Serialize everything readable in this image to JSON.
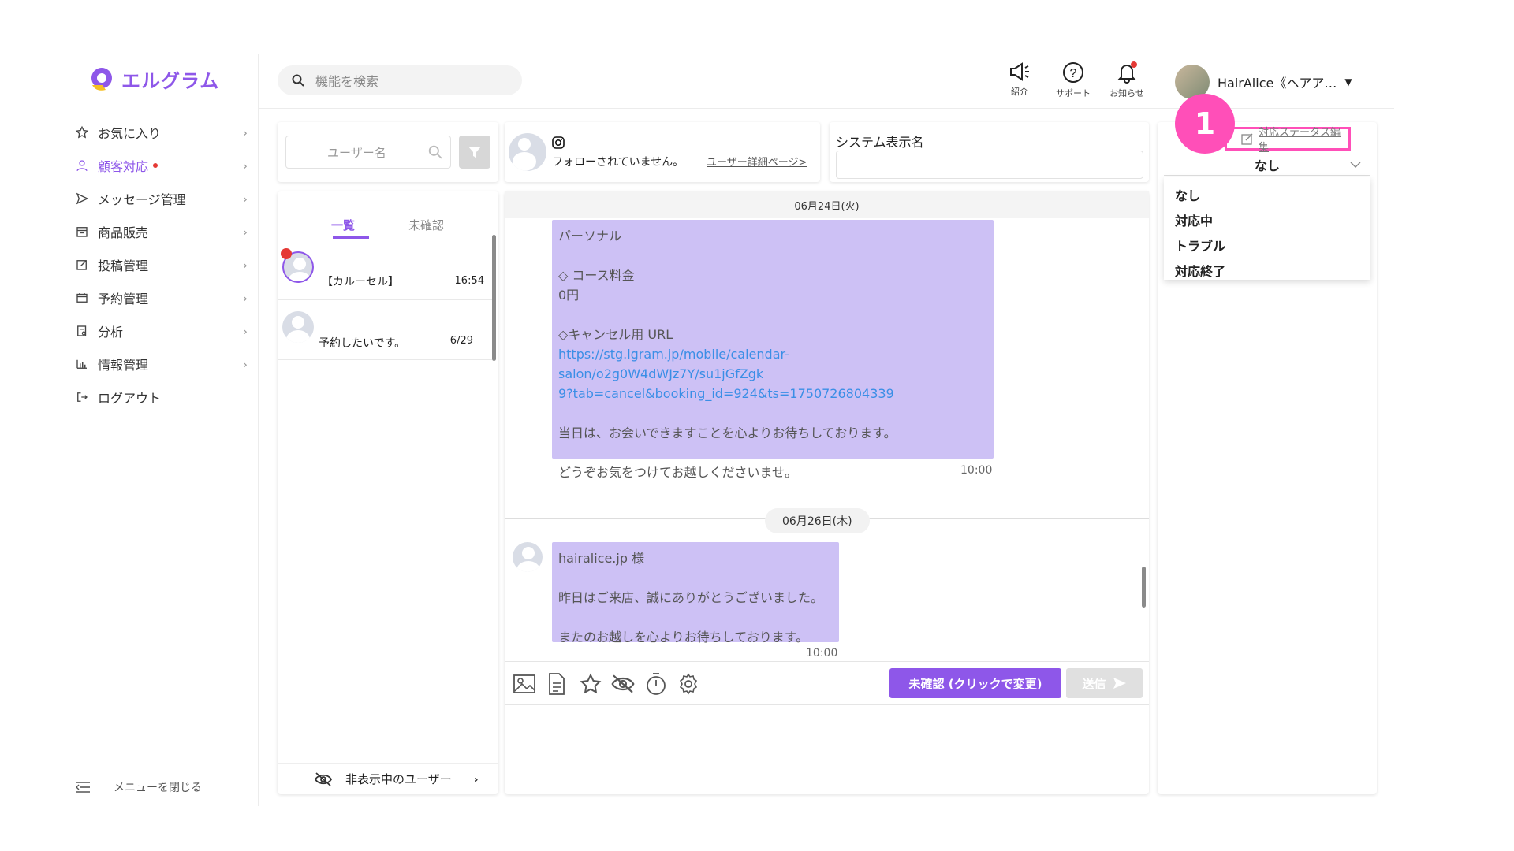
{
  "app": {
    "name": "エルグラム"
  },
  "search": {
    "placeholder": "機能を検索"
  },
  "header": {
    "icons": [
      {
        "name": "megaphone-icon",
        "label": "紹介"
      },
      {
        "name": "help-icon",
        "label": "サポート"
      },
      {
        "name": "bell-icon",
        "label": "お知らせ"
      }
    ],
    "user_name": "HairAlice《ヘアア…"
  },
  "sidebar": {
    "items": [
      {
        "label": "お気に入り",
        "icon": "star-icon"
      },
      {
        "label": "顧客対応",
        "icon": "person-icon",
        "active": true,
        "badge": true
      },
      {
        "label": "メッセージ管理",
        "icon": "send-icon"
      },
      {
        "label": "商品販売",
        "icon": "store-icon"
      },
      {
        "label": "投稿管理",
        "icon": "edit-icon"
      },
      {
        "label": "予約管理",
        "icon": "calendar-icon"
      },
      {
        "label": "分析",
        "icon": "report-icon"
      },
      {
        "label": "情報管理",
        "icon": "bar-chart-icon"
      },
      {
        "label": "ログアウト",
        "icon": "logout-icon"
      }
    ],
    "close_menu": "メニューを閉じる"
  },
  "user_list": {
    "search_placeholder": "ユーザー名",
    "tabs": [
      "一覧",
      "未確認"
    ],
    "rows": [
      {
        "message": "【カルーセル】",
        "time": "16:54",
        "unread": true
      },
      {
        "message": "予約したいです。",
        "time": "6/29",
        "unread": false
      }
    ],
    "hidden_users": "非表示中のユーザー"
  },
  "profile": {
    "status": "フォローされていません。",
    "detail_link": "ユーザー詳細ページ>"
  },
  "system_name": {
    "label": "システム表示名",
    "value": ""
  },
  "status_panel": {
    "edit_link": "対応ステータス編集",
    "selected": "なし",
    "options": [
      "なし",
      "対応中",
      "トラブル",
      "対応終了"
    ],
    "callout_number": "1"
  },
  "chat": {
    "messages": [
      {
        "date": "06月24日(火)",
        "lines": [
          "パーソナル",
          "",
          "◇ コース料金",
          "0円",
          "",
          "◇キャンセル用 URL"
        ],
        "link": "https://stg.lgram.jp/mobile/calendar-salon/o2g0W4dWJz7Y/su1jGfZgk9?tab=cancel&booking_id=924&ts=1750726804339",
        "link_line1": "https://stg.lgram.jp/mobile/calendar-salon/o2g0W4dWJz7Y/su1jGfZgk",
        "link_line2": "9?tab=cancel&booking_id=924&ts=1750726804339",
        "tail1": "当日は、お会いできますことを心よりお待ちしております。",
        "tail2": "どうぞお気をつけてお越しくださいませ。",
        "time": "10:00"
      },
      {
        "date": "06月26日(木)",
        "line1": "hairalice.jp 様",
        "line2": "昨日はご来店、誠にありがとうございました。",
        "line3": "またのお越しを心よりお待ちしております。",
        "time": "10:00"
      }
    ],
    "unconfirmed_button": "未確認 (クリックで変更)",
    "send_button": "送信"
  },
  "colors": {
    "accent": "#8e57e9",
    "bubble": "#cdc1f5",
    "highlight": "#ff4fb8",
    "unread": "#e53935"
  }
}
